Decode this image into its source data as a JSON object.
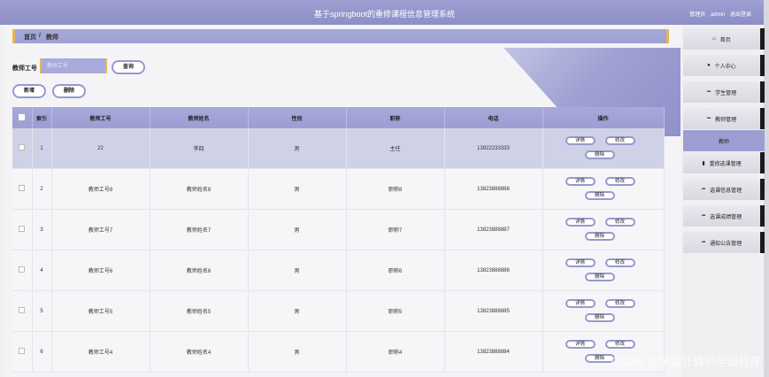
{
  "header": {
    "title": "基于springboot的重修课程信息管理系统",
    "user_prefix": "管理员",
    "user": "admin",
    "logout": "退出登录"
  },
  "breadcrumb": {
    "home": "首页",
    "sep": "/",
    "current": "教师"
  },
  "search": {
    "label": "教师工号",
    "placeholder": "教师工号",
    "button": "查询"
  },
  "actions": {
    "add": "新增",
    "delete": "删除"
  },
  "table": {
    "headers": [
      "",
      "索引",
      "教师工号",
      "教师姓名",
      "性别",
      "职称",
      "电话",
      "操作"
    ],
    "rows": [
      {
        "index": "1",
        "id": "22",
        "name": "李四",
        "gender": "男",
        "title": "主任",
        "phone": "13922233333"
      },
      {
        "index": "2",
        "id": "教师工号8",
        "name": "教师姓名8",
        "gender": "男",
        "title": "职称8",
        "phone": "13823888888"
      },
      {
        "index": "3",
        "id": "教师工号7",
        "name": "教师姓名7",
        "gender": "男",
        "title": "职称7",
        "phone": "13823888887"
      },
      {
        "index": "4",
        "id": "教师工号6",
        "name": "教师姓名6",
        "gender": "男",
        "title": "职称6",
        "phone": "13823888886"
      },
      {
        "index": "5",
        "id": "教师工号5",
        "name": "教师姓名5",
        "gender": "男",
        "title": "职称5",
        "phone": "13823888885"
      },
      {
        "index": "6",
        "id": "教师工号4",
        "name": "教师姓名4",
        "gender": "男",
        "title": "职称4",
        "phone": "13823888884"
      }
    ],
    "ops": {
      "detail": "详情",
      "edit": "修改",
      "delete": "删除"
    }
  },
  "sidebar": {
    "items": [
      {
        "label": "首页",
        "icon": "home-icon"
      },
      {
        "label": "个人中心",
        "icon": "user-icon"
      },
      {
        "label": "学生管理",
        "icon": "grid-icon"
      },
      {
        "label": "教师管理",
        "icon": "grid-icon"
      },
      {
        "label": "教师",
        "icon": ""
      },
      {
        "label": "重修选课管理",
        "icon": "doc-icon"
      },
      {
        "label": "选课信息管理",
        "icon": "grid-icon"
      },
      {
        "label": "选课成绩管理",
        "icon": "grid-icon"
      },
      {
        "label": "通知公告管理",
        "icon": "grid-icon"
      }
    ]
  },
  "watermark": "CSDN @学姐计算机毕设程序"
}
